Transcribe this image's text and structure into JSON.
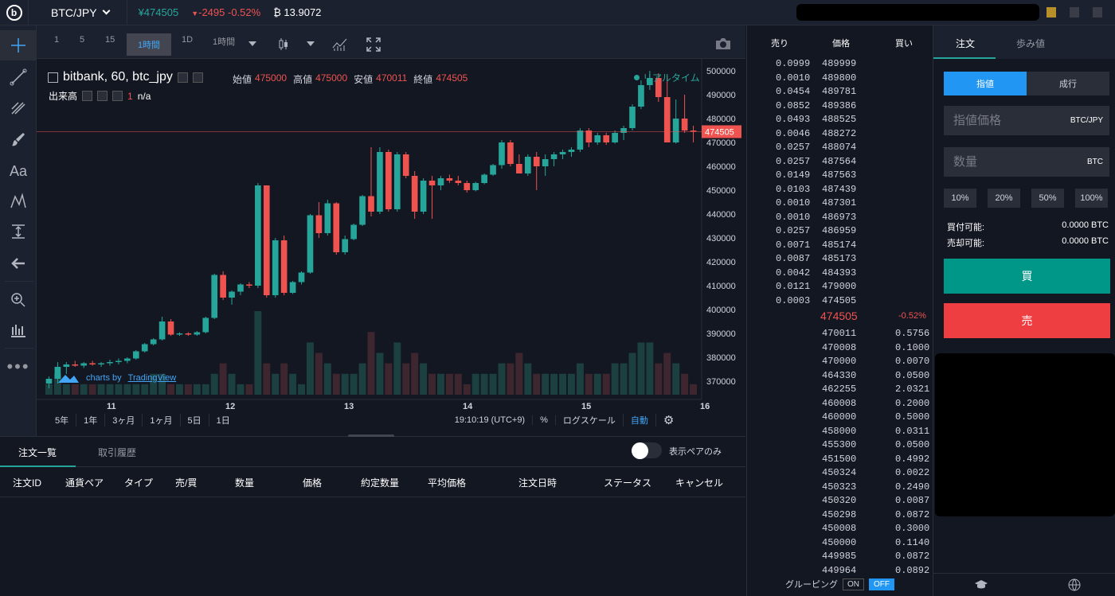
{
  "top": {
    "logo": "b",
    "pair": "BTC/JPY",
    "price": "¥474505",
    "change_arrow": "▼",
    "change": "-2495 -0.52%",
    "volume": "₿ 13.9072"
  },
  "chart_toolbar": {
    "intervals": [
      "1",
      "5",
      "15",
      "1時間",
      "1D",
      "1時間"
    ],
    "selected": "1時間"
  },
  "legend": {
    "title": "bitbank, 60, btc_jpy",
    "open_label": "始値",
    "open": "475000",
    "high_label": "高値",
    "high": "475000",
    "low_label": "安値",
    "low": "470011",
    "close_label": "終値",
    "close": "474505",
    "vol_label": "出来高",
    "vol_value": "1",
    "vol_na": "n/a",
    "realtime": "リアルタイム",
    "tv_text": "charts by",
    "tv_brand": "TradingView"
  },
  "chart_bottom": {
    "ranges": [
      "5年",
      "1年",
      "3ヶ月",
      "1ヶ月",
      "5日",
      "1日"
    ],
    "time": "19:10:19 (UTC+9)",
    "pct": "%",
    "log": "ログスケール",
    "auto": "自動"
  },
  "chart_data": {
    "type": "candlestick",
    "price_axis": [
      500000,
      490000,
      480000,
      470000,
      460000,
      450000,
      440000,
      430000,
      420000,
      410000,
      400000,
      390000,
      380000,
      370000
    ],
    "time_axis": [
      "11",
      "12",
      "13",
      "14",
      "15",
      "16"
    ],
    "last_price": 474505,
    "ylim": [
      365000,
      503000
    ],
    "candles": [
      [
        369000,
        372000,
        367000,
        371000
      ],
      [
        371000,
        378000,
        369000,
        376000
      ],
      [
        376000,
        378000,
        373000,
        377000
      ],
      [
        377000,
        378500,
        376000,
        376500
      ],
      [
        376500,
        378000,
        375500,
        377500
      ],
      [
        377500,
        378500,
        376500,
        377000
      ],
      [
        377000,
        378000,
        376000,
        377500
      ],
      [
        377500,
        379000,
        376500,
        378000
      ],
      [
        378000,
        379500,
        377000,
        378500
      ],
      [
        378500,
        380000,
        377500,
        379500
      ],
      [
        379500,
        383000,
        379000,
        382500
      ],
      [
        382500,
        386000,
        382000,
        385500
      ],
      [
        385500,
        388000,
        385000,
        387500
      ],
      [
        387500,
        397000,
        387000,
        395000
      ],
      [
        395000,
        396000,
        389000,
        389500
      ],
      [
        389500,
        390500,
        389000,
        390000
      ],
      [
        390000,
        390500,
        389000,
        389500
      ],
      [
        389500,
        391000,
        389000,
        390500
      ],
      [
        390500,
        397000,
        390000,
        396500
      ],
      [
        396500,
        415000,
        396000,
        414500
      ],
      [
        414500,
        416000,
        404000,
        405000
      ],
      [
        405000,
        408000,
        402000,
        407500
      ],
      [
        407500,
        411000,
        406000,
        410500
      ],
      [
        410500,
        411500,
        409000,
        410000
      ],
      [
        410000,
        453000,
        409000,
        452000
      ],
      [
        452000,
        434000,
        405000,
        406000
      ],
      [
        406000,
        430000,
        405000,
        429000
      ],
      [
        429000,
        431000,
        406000,
        407000
      ],
      [
        407000,
        412000,
        406500,
        411500
      ],
      [
        411500,
        416000,
        410500,
        415500
      ],
      [
        415500,
        440000,
        415000,
        439500
      ],
      [
        439500,
        445000,
        430000,
        432000
      ],
      [
        432000,
        446000,
        431000,
        444500
      ],
      [
        444500,
        445000,
        423000,
        424000
      ],
      [
        424000,
        431000,
        423000,
        429500
      ],
      [
        429500,
        436000,
        429000,
        435500
      ],
      [
        435500,
        448000,
        435000,
        447500
      ],
      [
        447500,
        468000,
        439000,
        441000
      ],
      [
        441000,
        468000,
        440000,
        466000
      ],
      [
        466000,
        467000,
        441000,
        442000
      ],
      [
        442000,
        466000,
        441000,
        465000
      ],
      [
        465000,
        466000,
        455000,
        456000
      ],
      [
        456000,
        458000,
        438000,
        441000
      ],
      [
        441000,
        455000,
        440000,
        454000
      ],
      [
        454000,
        456000,
        438000,
        452000
      ],
      [
        452000,
        456000,
        450000,
        455000
      ],
      [
        455000,
        456500,
        453000,
        454000
      ],
      [
        454000,
        456000,
        452000,
        453000
      ],
      [
        453000,
        454000,
        449000,
        450000
      ],
      [
        450000,
        453500,
        449500,
        453000
      ],
      [
        453000,
        457000,
        452500,
        456500
      ],
      [
        456500,
        461000,
        456000,
        460500
      ],
      [
        460500,
        471000,
        459000,
        470000
      ],
      [
        470000,
        471000,
        460000,
        461000
      ],
      [
        461000,
        465000,
        458000,
        457000
      ],
      [
        457000,
        465000,
        456000,
        464000
      ],
      [
        464000,
        466000,
        450000,
        460000
      ],
      [
        460000,
        465000,
        456000,
        463000
      ],
      [
        463000,
        466000,
        460000,
        465000
      ],
      [
        465000,
        467000,
        463000,
        466000
      ],
      [
        466000,
        468000,
        464000,
        467000
      ],
      [
        467000,
        476000,
        466000,
        475000
      ],
      [
        475000,
        476000,
        468000,
        470000
      ],
      [
        470000,
        474000,
        469000,
        473000
      ],
      [
        473000,
        474000,
        469000,
        470000
      ],
      [
        470000,
        475000,
        469500,
        474000
      ],
      [
        474000,
        477000,
        471000,
        476000
      ],
      [
        476000,
        486000,
        475000,
        485000
      ],
      [
        485000,
        496000,
        484000,
        494000
      ],
      [
        494000,
        500000,
        492000,
        497000
      ],
      [
        497000,
        499000,
        487000,
        489000
      ],
      [
        489000,
        498000,
        470000,
        470000
      ],
      [
        470000,
        488000,
        469500,
        480000
      ],
      [
        480000,
        490000,
        474000,
        475000
      ],
      [
        475000,
        477000,
        470011,
        474505
      ]
    ],
    "volumes": [
      1,
      2,
      1,
      1,
      1,
      1,
      1,
      1,
      1,
      1,
      1,
      1,
      2,
      2,
      1,
      1,
      1,
      1,
      1,
      2,
      3,
      2,
      1,
      1,
      8,
      3,
      2,
      3,
      2,
      1,
      5,
      4,
      3,
      2,
      2,
      2,
      3,
      6,
      4,
      3,
      5,
      3,
      4,
      3,
      2,
      2,
      2,
      2,
      1,
      2,
      2,
      2,
      3,
      3,
      4,
      3,
      2,
      2,
      2,
      2,
      2,
      3,
      2,
      2,
      2,
      3,
      3,
      4,
      5,
      5,
      3,
      4,
      3,
      2,
      1
    ]
  },
  "orders": {
    "tabs": [
      "注文一覧",
      "取引履歴"
    ],
    "toggle_label": "表示ペアのみ",
    "columns": [
      "注文ID",
      "通貨ペア",
      "タイプ",
      "売/買",
      "数量",
      "価格",
      "約定数量",
      "平均価格",
      "注文日時",
      "ステータス",
      "キャンセル"
    ]
  },
  "book": {
    "headers": [
      "売り",
      "価格",
      "買い"
    ],
    "asks": [
      [
        "0.0999",
        "489999"
      ],
      [
        "0.0010",
        "489800"
      ],
      [
        "0.0454",
        "489781"
      ],
      [
        "0.0852",
        "489386"
      ],
      [
        "0.0493",
        "488525"
      ],
      [
        "0.0046",
        "488272"
      ],
      [
        "0.0257",
        "488074"
      ],
      [
        "0.0257",
        "487564"
      ],
      [
        "0.0149",
        "487563"
      ],
      [
        "0.0103",
        "487439"
      ],
      [
        "0.0010",
        "487301"
      ],
      [
        "0.0010",
        "486973"
      ],
      [
        "0.0257",
        "486959"
      ],
      [
        "0.0071",
        "485174"
      ],
      [
        "0.0087",
        "485173"
      ],
      [
        "0.0042",
        "484393"
      ],
      [
        "0.0121",
        "479000"
      ],
      [
        "0.0003",
        "474505"
      ]
    ],
    "mid": "474505",
    "mid_pct": "-0.52%",
    "bids": [
      [
        "470011",
        "0.5756"
      ],
      [
        "470008",
        "0.1000"
      ],
      [
        "470000",
        "0.0070"
      ],
      [
        "464330",
        "0.0500"
      ],
      [
        "462255",
        "2.0321"
      ],
      [
        "460008",
        "0.2000"
      ],
      [
        "460000",
        "0.5000"
      ],
      [
        "458000",
        "0.0311"
      ],
      [
        "455300",
        "0.0500"
      ],
      [
        "451500",
        "0.4992"
      ],
      [
        "450324",
        "0.0022"
      ],
      [
        "450323",
        "0.2490"
      ],
      [
        "450320",
        "0.0087"
      ],
      [
        "450298",
        "0.0872"
      ],
      [
        "450008",
        "0.3000"
      ],
      [
        "450000",
        "0.1140"
      ],
      [
        "449985",
        "0.0872"
      ],
      [
        "449964",
        "0.0892"
      ]
    ],
    "grouping": "グルーピング",
    "on": "ON",
    "off": "OFF"
  },
  "trade": {
    "tabs": [
      "注文",
      "歩み値"
    ],
    "segments": [
      "指値",
      "成行"
    ],
    "price_placeholder": "指値価格",
    "price_unit": "BTC/JPY",
    "qty_placeholder": "数量",
    "qty_unit": "BTC",
    "pcts": [
      "10%",
      "20%",
      "50%",
      "100%"
    ],
    "buy_avail_label": "買付可能:",
    "buy_avail": "0.0000 BTC",
    "sell_avail_label": "売却可能:",
    "sell_avail": "0.0000 BTC",
    "buy": "買",
    "sell": "売"
  }
}
